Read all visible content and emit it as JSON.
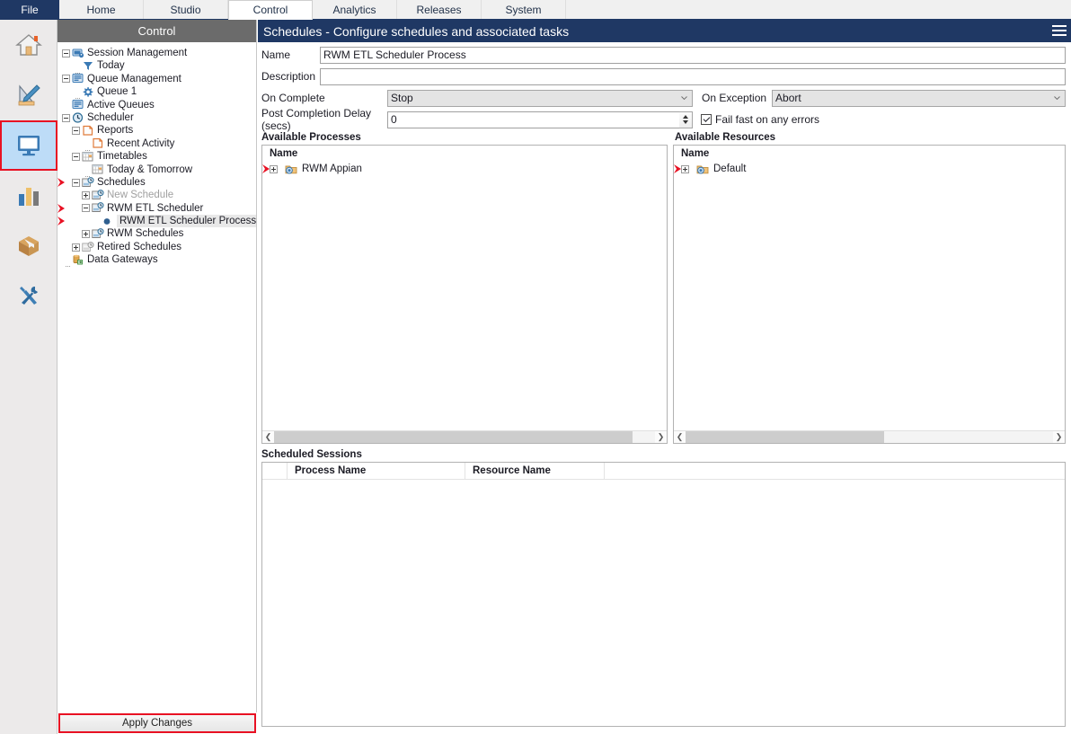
{
  "ribbon": {
    "file_label": "File",
    "tabs": [
      {
        "label": "Home",
        "active": false
      },
      {
        "label": "Studio",
        "active": false
      },
      {
        "label": "Control",
        "active": true
      },
      {
        "label": "Analytics",
        "active": false
      },
      {
        "label": "Releases",
        "active": false
      },
      {
        "label": "System",
        "active": false
      }
    ]
  },
  "rail": {
    "items": [
      {
        "name": "home-icon",
        "selected": false
      },
      {
        "name": "studio-icon",
        "selected": false
      },
      {
        "name": "control-monitor-icon",
        "selected": true
      },
      {
        "name": "analytics-bars-icon",
        "selected": false
      },
      {
        "name": "releases-box-icon",
        "selected": false
      },
      {
        "name": "system-tools-icon",
        "selected": false
      }
    ]
  },
  "nav": {
    "title": "Control",
    "apply_label": "Apply Changes",
    "tree": [
      {
        "label": "Session Management",
        "indent": 0,
        "toggle": "minus",
        "icon": "session-icon",
        "marker": false,
        "dim": false,
        "selected": false
      },
      {
        "label": "Today",
        "indent": 1,
        "toggle": "dotted",
        "icon": "filter-icon",
        "marker": false,
        "dim": false,
        "selected": false
      },
      {
        "label": "Queue Management",
        "indent": 0,
        "toggle": "minus",
        "icon": "queue-icon",
        "marker": false,
        "dim": false,
        "selected": false
      },
      {
        "label": "Queue 1",
        "indent": 1,
        "toggle": "dotted",
        "icon": "gear-icon",
        "marker": false,
        "dim": false,
        "selected": false
      },
      {
        "label": "Active Queues",
        "indent": 0,
        "toggle": "none",
        "icon": "queue-icon",
        "marker": false,
        "dim": false,
        "selected": false
      },
      {
        "label": "Scheduler",
        "indent": 0,
        "toggle": "minus",
        "icon": "clock-icon",
        "marker": false,
        "dim": false,
        "selected": false
      },
      {
        "label": "Reports",
        "indent": 1,
        "toggle": "minus",
        "icon": "report-icon",
        "marker": false,
        "dim": false,
        "selected": false
      },
      {
        "label": "Recent Activity",
        "indent": 2,
        "toggle": "dotted",
        "icon": "report-icon",
        "marker": false,
        "dim": false,
        "selected": false
      },
      {
        "label": "Timetables",
        "indent": 1,
        "toggle": "minus",
        "icon": "timetable-icon",
        "marker": false,
        "dim": false,
        "selected": false
      },
      {
        "label": "Today & Tomorrow",
        "indent": 2,
        "toggle": "dotted",
        "icon": "timetable-icon",
        "marker": false,
        "dim": false,
        "selected": false
      },
      {
        "label": "Schedules",
        "indent": 1,
        "toggle": "minus",
        "icon": "schedule-icon",
        "marker": true,
        "dim": false,
        "selected": false
      },
      {
        "label": "New Schedule",
        "indent": 2,
        "toggle": "plus",
        "icon": "schedule-icon",
        "marker": false,
        "dim": true,
        "selected": false
      },
      {
        "label": "RWM ETL Scheduler",
        "indent": 2,
        "toggle": "minus",
        "icon": "schedule-icon",
        "marker": true,
        "dim": false,
        "selected": false
      },
      {
        "label": "RWM ETL Scheduler Process",
        "indent": 3,
        "toggle": "dot",
        "icon": "none",
        "marker": true,
        "dim": false,
        "selected": true
      },
      {
        "label": "RWM Schedules",
        "indent": 2,
        "toggle": "plus",
        "icon": "schedule-icon",
        "marker": false,
        "dim": false,
        "selected": false
      },
      {
        "label": "Retired Schedules",
        "indent": 1,
        "toggle": "plus",
        "icon": "schedule-gray-icon",
        "marker": false,
        "dim": false,
        "selected": false
      },
      {
        "label": "Data Gateways",
        "indent": 0,
        "toggle": "dotted",
        "icon": "gateway-icon",
        "marker": false,
        "dim": false,
        "selected": false
      }
    ]
  },
  "main": {
    "title": "Schedules - Configure schedules and associated tasks",
    "menu_icon": "hamburger-icon",
    "fields": {
      "name_label": "Name",
      "name_value": "RWM ETL Scheduler Process",
      "description_label": "Description",
      "description_value": "",
      "on_complete_label": "On Complete",
      "on_complete_value": "Stop",
      "on_exception_label": "On Exception",
      "on_exception_value": "Abort",
      "post_delay_label": "Post Completion Delay (secs)",
      "post_delay_value": "0",
      "fail_fast_label": "Fail fast on any errors",
      "fail_fast_checked": true
    },
    "processes": {
      "group_label": "Available Processes",
      "column_name": "Name",
      "rows": [
        {
          "label": "RWM Appian",
          "toggle": "plus",
          "icon": "folder-group-icon",
          "marker": true
        }
      ]
    },
    "resources": {
      "group_label": "Available Resources",
      "column_name": "Name",
      "rows": [
        {
          "label": "Default",
          "toggle": "plus",
          "icon": "folder-group-icon",
          "marker": true
        }
      ]
    },
    "sessions": {
      "group_label": "Scheduled Sessions",
      "columns": [
        "Process Name",
        "Resource Name"
      ],
      "rows": []
    }
  },
  "colors": {
    "ribbon_file": "#1f3864",
    "title_bar": "#1f3864",
    "nav_title": "#6b6b6b",
    "marker_red": "#e81123",
    "selection_blue": "#bddcf7"
  }
}
